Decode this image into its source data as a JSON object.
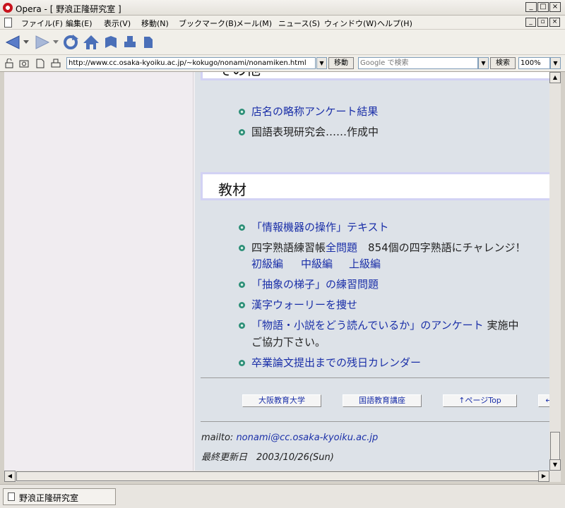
{
  "window": {
    "title": "Opera - [ 野浪正隆研究室 ]",
    "controls": [
      "_",
      "□",
      "×"
    ]
  },
  "menu": {
    "items": [
      "ファイル(F)",
      "編集(E)",
      "表示(V)",
      "移動(N)",
      "ブックマーク(B)",
      "メール(M)",
      "ニュース(S)",
      "ウィンドウ(W)",
      "ヘルプ(H)"
    ],
    "mdi_controls": [
      "_",
      "▫",
      "×"
    ]
  },
  "toolbar": {
    "icons": [
      "back-icon",
      "forward-icon",
      "reload-icon",
      "home-icon",
      "hotlist-icon",
      "print-icon",
      "page-icon"
    ]
  },
  "address_bar": {
    "url": "http://www.cc.osaka-kyoiku.ac.jp/~kokugo/nonami/nonamiken.html",
    "go_label": "移動",
    "search_placeholder": "Google で検索",
    "search_label": "検索",
    "zoom": "100%"
  },
  "page": {
    "section_other": {
      "title": "その他",
      "items": [
        {
          "link": "店名の略称アンケート結果",
          "text": ""
        },
        {
          "link": "",
          "text": "国語表現研究会……作成中"
        }
      ]
    },
    "section_materials": {
      "title": "教材",
      "items": {
        "item1": {
          "link": "「情報機器の操作」テキスト"
        },
        "item2": {
          "prefix": "四字熟語練習帳",
          "link": "全問題",
          "suffix": "854個の四字熟語にチャレンジ！",
          "levels": [
            "初級編",
            "中級編",
            "上級編"
          ]
        },
        "item3": {
          "link": "「抽象の梯子」の練習問題"
        },
        "item4": {
          "link": "漢字ウォーリーを捜せ"
        },
        "item5": {
          "link": "「物語・小説をどう読んでいるか」のアンケート",
          "suffix": "実施中",
          "line2": "ご協力下さい。"
        },
        "item6": {
          "link": "卒業論文提出までの残日カレンダー"
        }
      }
    },
    "footer_nav": [
      "大阪教育大学",
      "国語教育講座",
      "↑ページTop",
      "←"
    ],
    "footer": {
      "mailto_label": "mailto:",
      "email": "nonami@cc.osaka-kyoiku.ac.jp",
      "updated": "最終更新日　2003/10/26(Sun)"
    }
  },
  "status": {
    "tab_title": "野浪正隆研究室"
  }
}
